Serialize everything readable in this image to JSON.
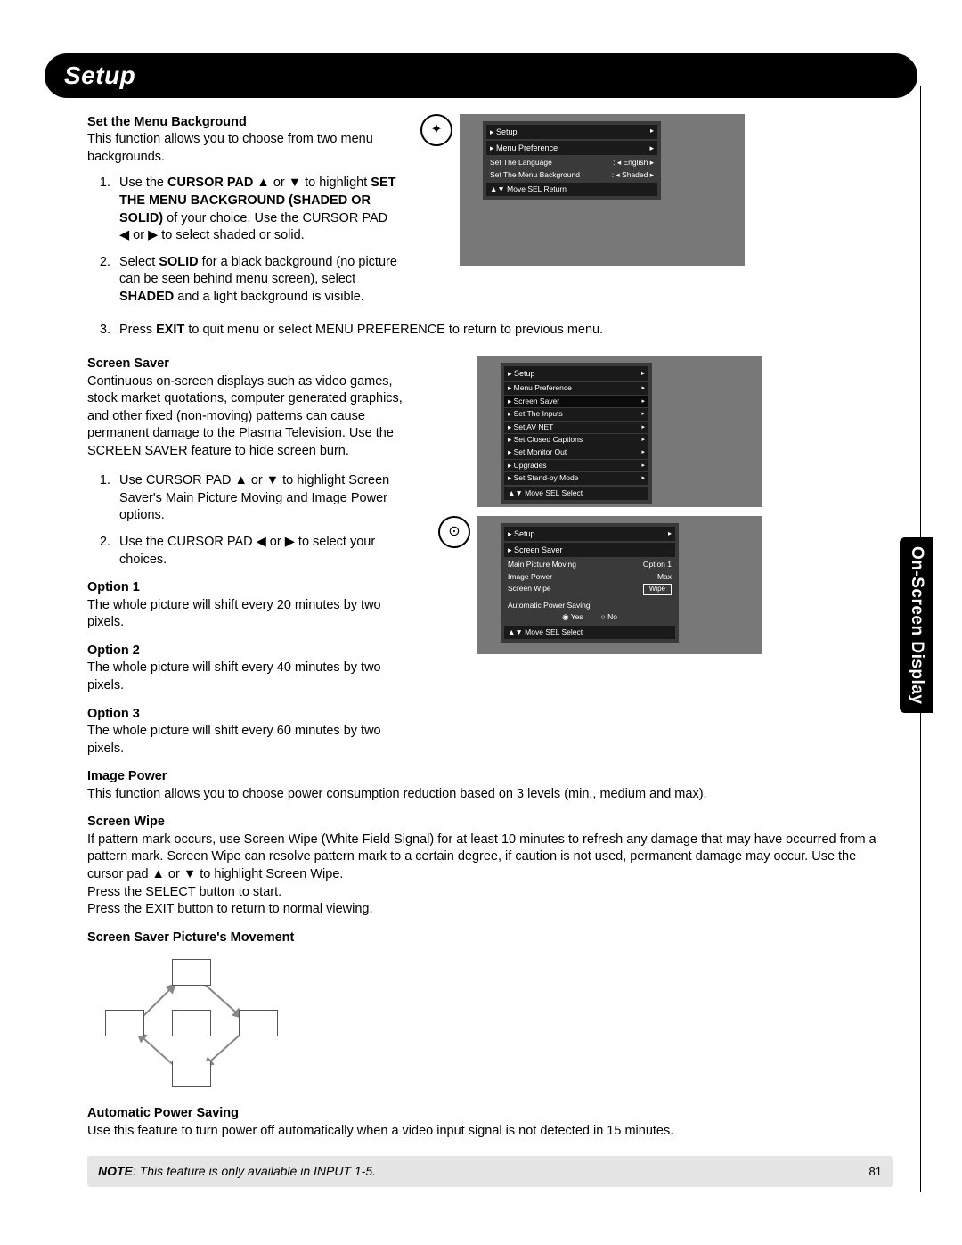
{
  "header": {
    "title": "Setup"
  },
  "side_tab": "On-Screen Display",
  "set_menu_bg": {
    "heading": "Set the Menu Background",
    "intro": "This function allows you to choose from two menu backgrounds.",
    "step1_a": "Use the ",
    "step1_b": "CURSOR PAD",
    "step1_c": " ▲ or ▼ to highlight ",
    "step1_d": "SET THE MENU BACKGROUND (SHADED OR SOLID)",
    "step1_e": " of your choice.  Use the CURSOR PAD ◀ or ▶ to select shaded or solid.",
    "step2_a": "Select ",
    "step2_b": "SOLID",
    "step2_c": " for a black background (no picture can be seen behind menu screen), select ",
    "step2_d": "SHADED",
    "step2_e": " and a light background is visible.",
    "step3_a": "Press ",
    "step3_b": "EXIT",
    "step3_c": " to quit menu or select MENU PREFERENCE to return to previous menu."
  },
  "screen_saver": {
    "heading": "Screen Saver",
    "intro": "Continuous on-screen displays such as video games, stock market quotations, computer generated graphics, and other fixed (non-moving) patterns can cause permanent damage to the Plasma Television.  Use the SCREEN SAVER feature to hide screen burn.",
    "step1": "Use CURSOR PAD ▲ or ▼ to highlight Screen Saver's Main Picture Moving and Image Power options.",
    "step2": "Use the CURSOR PAD ◀ or ▶ to select your choices.",
    "opt1_h": "Option 1",
    "opt1_t": "The whole picture will shift every 20 minutes by two pixels.",
    "opt2_h": "Option 2",
    "opt2_t": "The whole picture will shift every 40 minutes by two pixels.",
    "opt3_h": "Option 3",
    "opt3_t": "The whole picture will shift every 60 minutes by two pixels.",
    "image_power_h": "Image Power",
    "image_power_t": "This function allows you to choose power consumption reduction based on 3 levels (min., medium and max).",
    "screen_wipe_h": "Screen Wipe",
    "screen_wipe_t": "If pattern mark occurs, use Screen Wipe (White Field Signal) for at least 10 minutes to refresh any damage that may have occurred from a pattern mark.  Screen Wipe can resolve pattern mark to a certain degree, if caution is not used, permanent damage may occur.  Use the cursor pad ▲ or ▼ to highlight Screen Wipe.",
    "screen_wipe_t2": "Press the SELECT button to start.",
    "screen_wipe_t3": "Press the EXIT button to return to normal viewing.",
    "movement_h": "Screen Saver Picture's Movement",
    "auto_power_h": "Automatic Power Saving",
    "auto_power_t": "Use this feature to turn power off automatically when a video input signal is not detected in 15 minutes."
  },
  "note": {
    "label": "NOTE",
    "text": ": This feature is only available in INPUT 1-5.",
    "page": "81"
  },
  "osd1": {
    "crumb1": "Setup",
    "crumb2": "Menu Preference",
    "row1_l": "Set The Language",
    "row1_v": "English",
    "row2_l": "Set The Menu Background",
    "row2_v": "Shaded",
    "footer": "▲▼ Move   SEL Return"
  },
  "osd2": {
    "crumb1": "Setup",
    "items": [
      "Menu Preference",
      "Screen Saver",
      "Set The Inputs",
      "Set AV NET",
      "Set Closed Captions",
      "Set Monitor Out",
      "Upgrades",
      "Set Stand-by Mode"
    ],
    "footer": "▲▼ Move   SEL Select"
  },
  "osd3": {
    "crumb1": "Setup",
    "crumb2": "Screen Saver",
    "r1_l": "Main Picture Moving",
    "r1_v": "Option 1",
    "r2_l": "Image Power",
    "r2_v": "Max",
    "r3_l": "Screen Wipe",
    "r3_v": "Wipe",
    "r4_l": "Automatic Power Saving",
    "r4_yes": "Yes",
    "r4_no": "No",
    "footer": "▲▼ Move   SEL Select"
  }
}
